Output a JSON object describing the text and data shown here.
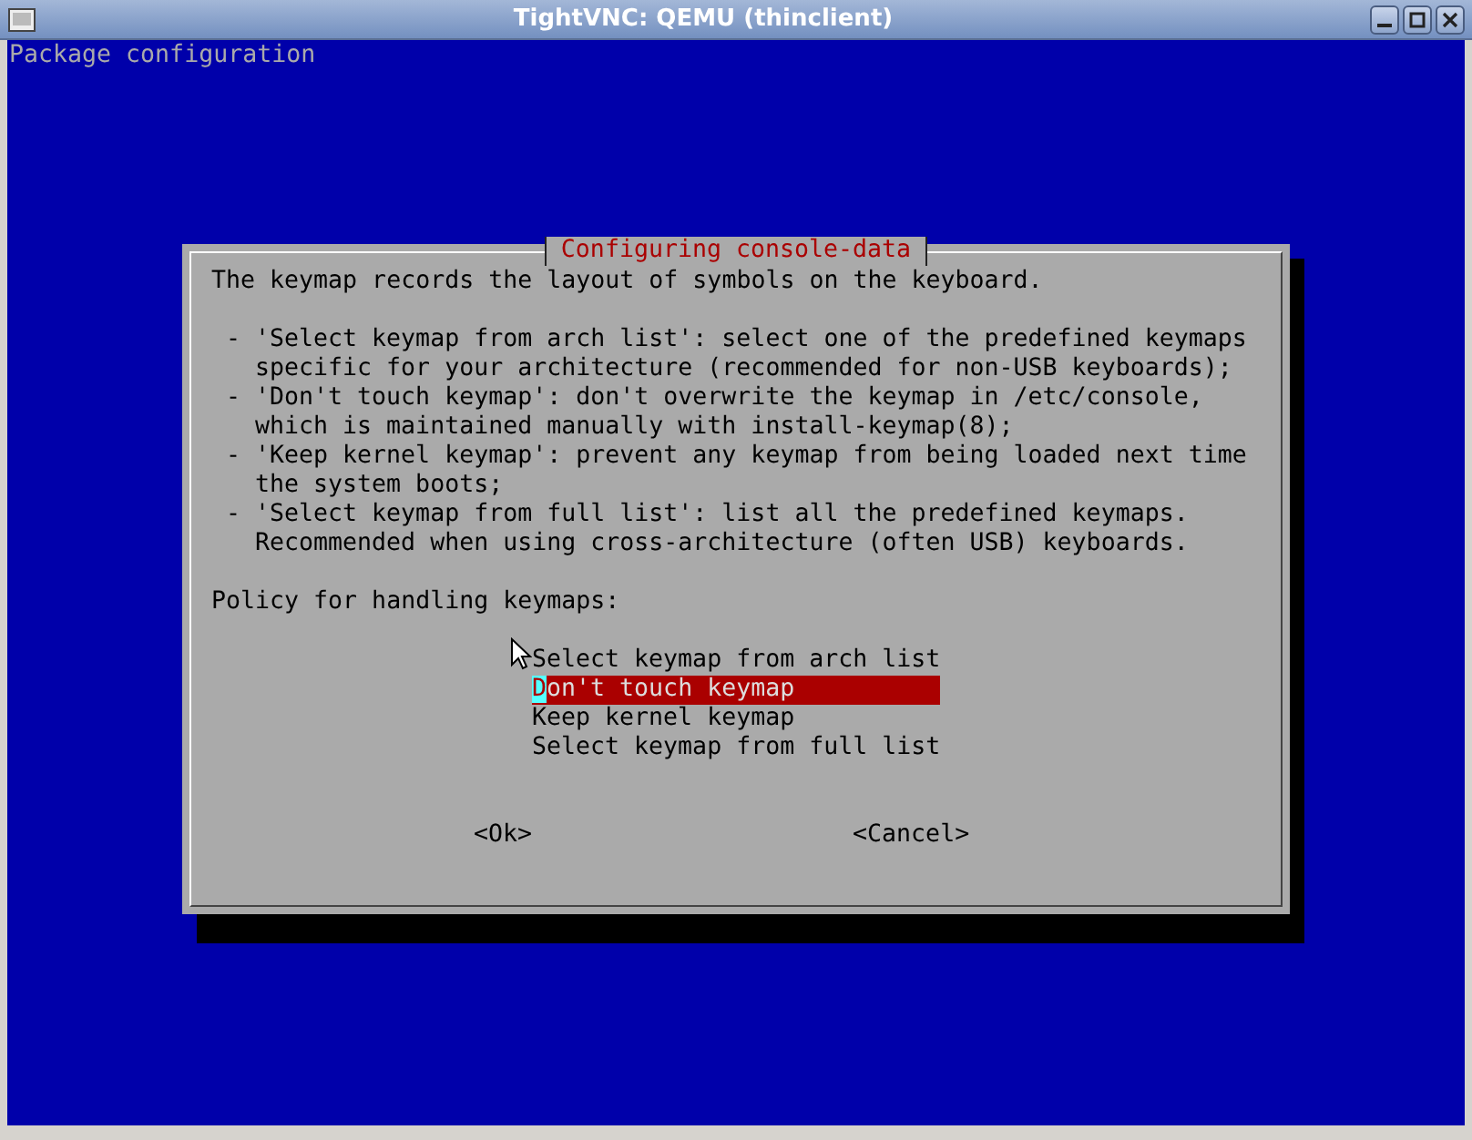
{
  "window": {
    "title": "TightVNC: QEMU (thinclient)"
  },
  "console": {
    "header": "Package configuration"
  },
  "dialog": {
    "title": "Configuring console-data",
    "intro": "The keymap records the layout of symbols on the keyboard.",
    "bullets": [
      {
        "marker": "-",
        "lines": [
          "'Select keymap from arch list': select one of the predefined keymaps",
          "specific for your architecture (recommended for non-USB keyboards);"
        ]
      },
      {
        "marker": "-",
        "lines": [
          "'Don't touch keymap': don't overwrite the keymap in /etc/console,",
          "which is maintained manually with install-keymap(8);"
        ]
      },
      {
        "marker": "-",
        "lines": [
          "'Keep kernel keymap': prevent any keymap from being loaded next time",
          "the system boots;"
        ]
      },
      {
        "marker": "-",
        "lines": [
          "'Select keymap from full list': list all the predefined keymaps.",
          "Recommended when using cross-architecture (often USB) keyboards."
        ]
      }
    ],
    "prompt": "Policy for handling keymaps:",
    "options": [
      {
        "label": "Select keymap from arch list",
        "selected": false
      },
      {
        "label": "Don't touch keymap",
        "selected": true
      },
      {
        "label": "Keep kernel keymap",
        "selected": false
      },
      {
        "label": "Select keymap from full list",
        "selected": false
      }
    ],
    "buttons": [
      "<Ok>",
      "<Cancel>"
    ]
  }
}
